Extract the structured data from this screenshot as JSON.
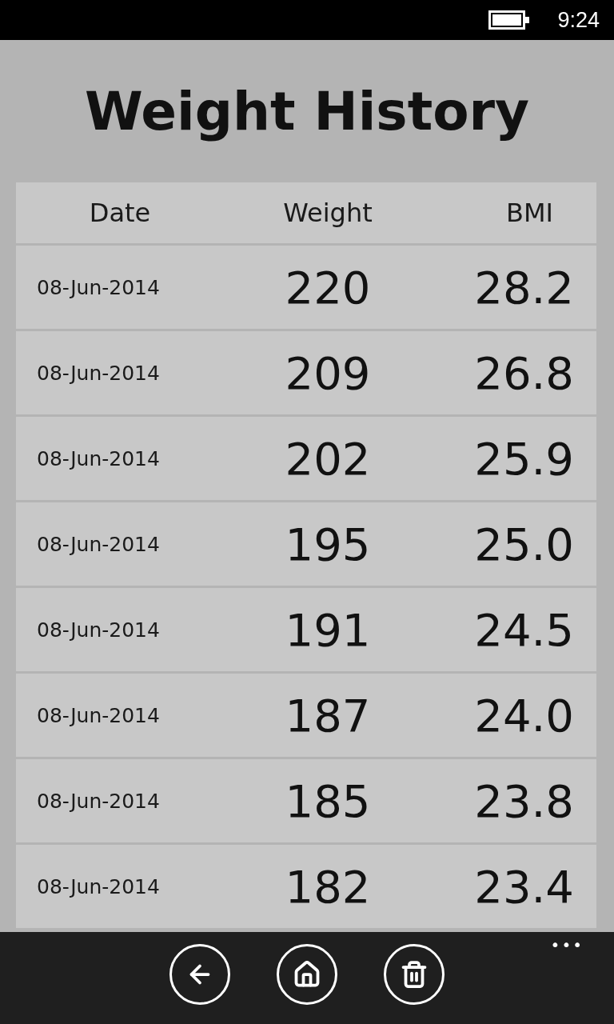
{
  "status_bar": {
    "time": "9:24"
  },
  "title": "Weight History",
  "table": {
    "columns": [
      "Date",
      "Weight",
      "BMI"
    ],
    "rows": [
      {
        "date": "08-Jun-2014",
        "weight": "220",
        "bmi": "28.2"
      },
      {
        "date": "08-Jun-2014",
        "weight": "209",
        "bmi": "26.8"
      },
      {
        "date": "08-Jun-2014",
        "weight": "202",
        "bmi": "25.9"
      },
      {
        "date": "08-Jun-2014",
        "weight": "195",
        "bmi": "25.0"
      },
      {
        "date": "08-Jun-2014",
        "weight": "191",
        "bmi": "24.5"
      },
      {
        "date": "08-Jun-2014",
        "weight": "187",
        "bmi": "24.0"
      },
      {
        "date": "08-Jun-2014",
        "weight": "185",
        "bmi": "23.8"
      },
      {
        "date": "08-Jun-2014",
        "weight": "182",
        "bmi": "23.4"
      }
    ]
  },
  "app_bar": {
    "buttons": [
      {
        "kind": "back"
      },
      {
        "kind": "home"
      },
      {
        "kind": "delete"
      }
    ],
    "more": "•••"
  }
}
